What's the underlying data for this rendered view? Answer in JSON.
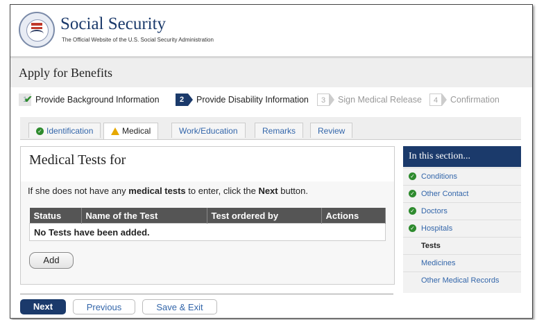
{
  "header": {
    "brand": "Social Security",
    "tagline": "The Official Website of the U.S. Social Security Administration",
    "seal_text": "SOCIAL SECURITY ADMINISTRATION USA"
  },
  "page_title": "Apply for Benefits",
  "steps": [
    {
      "num": "1",
      "label": "Provide Background Information",
      "state": "done"
    },
    {
      "num": "2",
      "label": "Provide Disability Information",
      "state": "current"
    },
    {
      "num": "3",
      "label": "Sign Medical Release",
      "state": "future"
    },
    {
      "num": "4",
      "label": "Confirmation",
      "state": "future"
    }
  ],
  "tabs": [
    {
      "label": "Identification",
      "icon": "check-circle-icon"
    },
    {
      "label": "Medical",
      "icon": "warning-icon",
      "active": true
    },
    {
      "label": "Work/Education"
    },
    {
      "label": "Remarks"
    },
    {
      "label": "Review"
    }
  ],
  "main": {
    "heading": "Medical Tests for",
    "instruction_pre": "If she does not have any ",
    "instruction_bold1": "medical tests",
    "instruction_mid": " to enter, click the ",
    "instruction_bold2": "Next",
    "instruction_post": " button.",
    "table": {
      "headers": [
        "Status",
        "Name of the Test",
        "Test ordered by",
        "Actions"
      ],
      "empty_message": "No Tests have been added."
    },
    "add_label": "Add"
  },
  "sidebar": {
    "heading": "In this section...",
    "items": [
      {
        "label": "Conditions",
        "done": true
      },
      {
        "label": "Other Contact",
        "done": true
      },
      {
        "label": "Doctors",
        "done": true
      },
      {
        "label": "Hospitals",
        "done": true
      },
      {
        "label": "Tests",
        "current": true
      },
      {
        "label": "Medicines"
      },
      {
        "label": "Other Medical Records"
      }
    ]
  },
  "buttons": {
    "next": "Next",
    "previous": "Previous",
    "save_exit": "Save & Exit"
  },
  "colors": {
    "brand_navy": "#1b3a6b",
    "link_blue": "#3366aa",
    "success_green": "#2e8b2e",
    "warning_amber": "#e6a800",
    "table_header": "#555555"
  }
}
